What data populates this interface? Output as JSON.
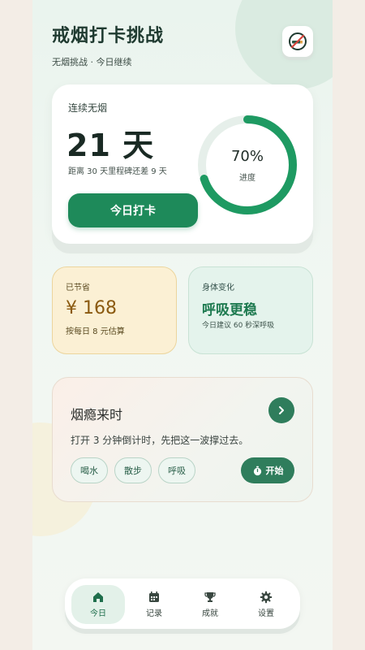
{
  "header": {
    "title": "戒烟打卡挑战",
    "subtitle": "无烟挑战 · 今日继续",
    "icon": "no-smoking-icon"
  },
  "streak": {
    "label": "连续无烟",
    "days": "21 天",
    "note": "距离 30 天里程碑还差 9 天",
    "button": "今日打卡",
    "progress_text": "70%",
    "progress_value": 0.7,
    "progress_label": "进度"
  },
  "saved": {
    "label": "已节省",
    "amount": "¥ 168",
    "note": "按每日 8 元估算"
  },
  "body_change": {
    "label": "身体变化",
    "value": "呼吸更稳",
    "note": "今日建议 60 秒深呼吸"
  },
  "craving": {
    "title": "烟瘾来时",
    "desc": "打开 3 分钟倒计时，先把这一波撑过去。",
    "chips": [
      "喝水",
      "散步",
      "呼吸"
    ],
    "start": "开始"
  },
  "tabs": [
    {
      "label": "今日",
      "icon": "home-icon",
      "active": true
    },
    {
      "label": "记录",
      "icon": "calendar-icon",
      "active": false
    },
    {
      "label": "成就",
      "icon": "trophy-icon",
      "active": false
    },
    {
      "label": "设置",
      "icon": "gear-icon",
      "active": false
    }
  ],
  "colors": {
    "accent": "#1e8a5a",
    "saved_bg": "#fbf0d4",
    "body_bg": "#e4f3ec"
  }
}
